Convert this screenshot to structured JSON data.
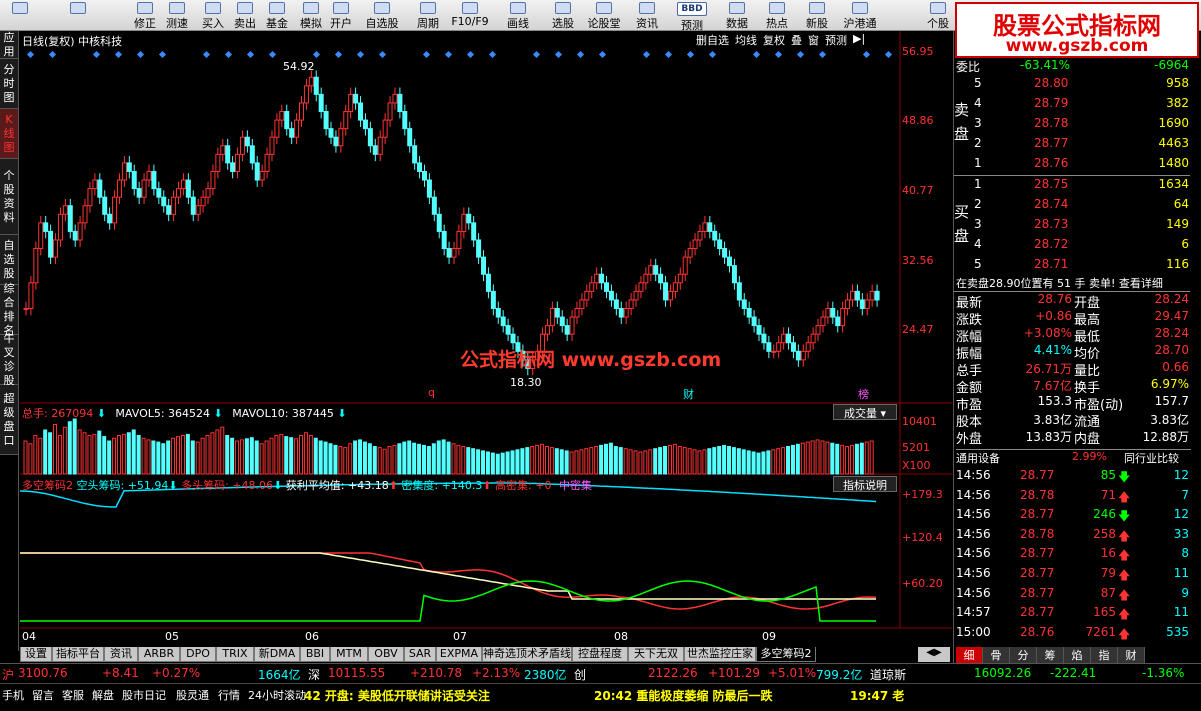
{
  "toolbar": {
    "buttons": [
      "",
      "",
      "修正",
      "测速",
      "买入",
      "卖出",
      "基金",
      "模拟",
      "开户",
      "自选股",
      "周期",
      "F10/F9",
      "画线",
      "选股",
      "论股堂",
      "资讯",
      "预测",
      "数据",
      "热点",
      "新股",
      "沪港通",
      "个股"
    ],
    "icons": [
      "home-icon",
      "back-icon",
      "fix-icon",
      "clock-icon",
      "buy-icon",
      "sell-icon",
      "fund-icon",
      "sim-icon",
      "account-icon",
      "star-icon",
      "period-icon",
      "f10-icon",
      "draw-icon",
      "pick-icon",
      "forum-icon",
      "news-icon",
      "forecast-icon",
      "pe-icon",
      "hot-icon",
      "ipo-icon",
      "hk-icon",
      "stock-icon"
    ],
    "bbd": "BBD"
  },
  "logo": {
    "line1": "股票公式指标网",
    "line2": "www.gszb.com"
  },
  "sidebar": [
    "应用",
    "分时图",
    "K线图",
    "个股资料",
    "自选股",
    "综合排名",
    "牛叉诊股",
    "超级盘口"
  ],
  "chart_header": {
    "title": "日线(复权) 中核科技",
    "menu": [
      "删自选",
      "均线",
      "复权",
      "叠",
      "窗",
      "预测"
    ]
  },
  "price_axis": [
    "56.95",
    "48.86",
    "40.77",
    "32.56",
    "24.47"
  ],
  "annotations": {
    "high": "54.92",
    "low": "18.30",
    "q": "q",
    "cai": "财",
    "bang": "榜"
  },
  "watermark": "公式指标网  www.gszb.com",
  "volume_panel": {
    "label": "总手: 267094",
    "mavol5": "MAVOL5: 364524",
    "mavol10": "MAVOL10: 387445",
    "button": "成交量",
    "axis": [
      "10401",
      "5201",
      "X100"
    ]
  },
  "indicator_panel": {
    "name": "多空筹码2",
    "kong": "空头筹码: +51.94",
    "duo": "多头筹码: +48.06",
    "avg": "获利平均值: +43.18",
    "density": "密集度: +140.3",
    "high": "高密集: +0",
    "mid": "中密集",
    "button": "指标说明",
    "axis": [
      "+179.3",
      "+120.4",
      "+60.20"
    ]
  },
  "date_axis": [
    "04",
    "05",
    "06",
    "07",
    "08",
    "09"
  ],
  "bottom_tabs": [
    "设置",
    "指标平台",
    "资讯",
    "ARBR",
    "DPO",
    "TRIX",
    "新DMA",
    "BBI",
    "MTM",
    "OBV",
    "SAR",
    "EXPMA",
    "神奇选顶术矛盾线",
    "控盘程度",
    "天下无双",
    "世杰监控庄家",
    "多空筹码2"
  ],
  "right_tabs": [
    "细",
    "骨",
    "分",
    "筹",
    "焰",
    "指",
    "财"
  ],
  "quote": {
    "weibi": {
      "label": "委比",
      "pct": "-63.41%",
      "diff": "-6964"
    },
    "sell": [
      {
        "n": "5",
        "p": "28.80",
        "v": "958"
      },
      {
        "n": "4",
        "p": "28.79",
        "v": "382"
      },
      {
        "n": "3",
        "p": "28.78",
        "v": "1690"
      },
      {
        "n": "2",
        "p": "28.77",
        "v": "4463"
      },
      {
        "n": "1",
        "p": "28.76",
        "v": "1480"
      }
    ],
    "buy": [
      {
        "n": "1",
        "p": "28.75",
        "v": "1634"
      },
      {
        "n": "2",
        "p": "28.74",
        "v": "64"
      },
      {
        "n": "3",
        "p": "28.73",
        "v": "149"
      },
      {
        "n": "4",
        "p": "28.72",
        "v": "6"
      },
      {
        "n": "5",
        "p": "28.71",
        "v": "116"
      }
    ],
    "sell_label": "卖盘",
    "buy_label": "买盘",
    "status": "在卖盘28.90位置有 51 手 卖单! 查看详细",
    "stats": [
      [
        "最新",
        "28.76",
        "开盘",
        "28.24"
      ],
      [
        "涨跌",
        "+0.86",
        "最高",
        "29.47"
      ],
      [
        "涨幅",
        "+3.08%",
        "最低",
        "28.24"
      ],
      [
        "振幅",
        "4.41%",
        "均价",
        "28.70"
      ],
      [
        "总手",
        "26.71万",
        "量比",
        "0.66"
      ],
      [
        "金额",
        "7.67亿",
        "换手",
        "6.97%"
      ],
      [
        "市盈",
        "153.3",
        "市盈(动)",
        "157.7"
      ],
      [
        "股本",
        "3.83亿",
        "流通",
        "3.83亿"
      ],
      [
        "外盘",
        "13.83万",
        "内盘",
        "12.88万"
      ]
    ],
    "industry": {
      "name": "通用设备",
      "pct": "2.99%",
      "btn": "同行业比较"
    },
    "ticks": [
      [
        "14:56",
        "28.77",
        "85",
        "down",
        "12"
      ],
      [
        "14:56",
        "28.78",
        "71",
        "up",
        "7"
      ],
      [
        "14:56",
        "28.77",
        "246",
        "down",
        "12"
      ],
      [
        "14:56",
        "28.78",
        "258",
        "up",
        "33"
      ],
      [
        "14:56",
        "28.77",
        "16",
        "up",
        "8"
      ],
      [
        "14:56",
        "28.77",
        "79",
        "up",
        "11"
      ],
      [
        "14:56",
        "28.77",
        "87",
        "up",
        "9"
      ],
      [
        "14:57",
        "28.77",
        "165",
        "up",
        "11"
      ],
      [
        "15:00",
        "28.76",
        "7261",
        "up",
        "535"
      ]
    ]
  },
  "status_bar": {
    "hu": "沪",
    "hu_val": "3100.76",
    "hu_chg": "+8.41",
    "hu_pct": "+0.27%",
    "hu_amt": "1664亿",
    "shen": "深",
    "shen_val": "10115.55",
    "shen_chg": "+210.78",
    "shen_pct": "+2.13%",
    "shen_amt": "2380亿",
    "chuang": "创",
    "chuang_val": "2122.26",
    "chuang_chg": "+101.29",
    "chuang_pct": "+5.01%",
    "chuang_amt": "799.2亿",
    "dow": "道琼斯",
    "dow_val": "16092.26",
    "dow_chg": "-222.41",
    "dow_pct": "-1.36%"
  },
  "footer": {
    "items": [
      "手机",
      "留言",
      "客服",
      "解盘",
      "股市日记",
      "股灵通",
      "行情",
      "24小时滚动"
    ],
    "news1": "42 开盘: 美股低开联储讲话受关注",
    "news2": "20:42 重能极度萎缩 防最后一跌",
    "time": "19:47 老"
  },
  "chart_data": {
    "type": "candlestick",
    "title": "日线(复权) 中核科技",
    "ylim": [
      18.3,
      56.95
    ],
    "y_ticks": [
      56.95,
      48.86,
      40.77,
      32.56,
      24.47
    ],
    "x_ticks": [
      "04",
      "05",
      "06",
      "07",
      "08",
      "09"
    ],
    "high_label": 54.92,
    "low_label": 18.3,
    "closes": [
      27,
      30,
      34,
      37,
      36,
      33,
      35,
      38,
      39,
      36,
      35,
      37,
      39,
      41,
      42,
      40,
      38,
      37,
      40,
      42,
      44,
      43,
      41,
      40,
      42,
      43,
      41,
      40,
      39,
      38,
      40,
      41,
      42,
      40,
      38,
      39,
      40,
      41,
      43,
      45,
      46,
      44,
      43,
      45,
      47,
      46,
      44,
      42,
      43,
      45,
      47,
      49,
      50,
      48,
      47,
      49,
      51,
      53,
      54,
      52,
      50,
      48,
      47,
      46,
      48,
      50,
      52,
      51,
      49,
      48,
      46,
      45,
      47,
      49,
      51,
      52,
      50,
      48,
      46,
      44,
      43,
      42,
      40,
      38,
      36,
      34,
      33,
      34,
      36,
      38,
      37,
      35,
      33,
      31,
      29,
      27,
      26,
      25,
      24,
      23,
      22,
      21,
      20,
      21,
      22,
      24,
      25,
      27,
      26,
      25,
      24,
      26,
      27,
      28,
      29,
      30,
      31,
      30,
      29,
      28,
      27,
      26,
      27,
      28,
      29,
      30,
      31,
      32,
      31,
      30,
      28,
      29,
      30,
      31,
      33,
      34,
      35,
      36,
      37,
      36,
      35,
      34,
      33,
      32,
      30,
      28,
      27,
      26,
      25,
      24,
      23,
      22,
      22,
      23,
      24,
      23,
      22,
      21,
      22,
      23,
      24,
      25,
      26,
      27,
      26,
      25,
      27,
      28,
      29,
      28,
      27,
      28,
      29,
      28
    ],
    "volume": [
      60,
      55,
      70,
      65,
      80,
      75,
      90,
      70,
      85,
      95,
      100,
      80,
      75,
      70,
      72,
      78,
      68,
      60,
      65,
      70,
      72,
      75,
      80,
      70,
      65,
      62,
      60,
      58,
      55,
      60,
      65,
      68,
      70,
      72,
      60,
      58,
      65,
      70,
      75,
      80,
      85,
      70,
      65,
      60,
      62,
      64,
      66,
      60,
      55,
      60,
      65,
      70,
      72,
      68,
      66,
      64,
      70,
      75,
      70,
      65,
      60,
      58,
      55,
      52,
      50,
      48,
      55,
      60,
      62,
      58,
      55,
      50,
      48,
      45,
      50,
      52,
      55,
      58,
      60,
      56,
      54,
      52,
      50,
      55,
      60,
      62,
      58,
      55,
      52,
      50,
      48,
      46,
      44,
      42,
      40,
      38,
      36,
      38,
      40,
      42,
      44,
      46,
      48,
      50,
      52,
      54,
      50,
      48,
      46,
      44,
      42,
      40,
      42,
      44,
      46,
      48,
      50,
      52,
      54,
      56,
      50,
      48,
      46,
      44,
      42,
      40,
      42,
      44,
      46,
      48,
      50,
      52,
      54,
      50,
      48,
      46,
      44,
      42,
      44,
      46,
      48,
      50,
      52,
      50,
      48,
      46,
      44,
      42,
      40,
      38,
      40,
      42,
      44,
      46,
      48,
      50,
      52,
      54,
      56,
      58,
      60,
      62,
      60,
      58,
      56,
      54,
      52,
      50,
      52,
      54,
      56,
      58,
      60
    ],
    "series": [
      {
        "name": "空头筹码",
        "color": "#00e0ff"
      },
      {
        "name": "多头筹码",
        "color": "#ff3333"
      },
      {
        "name": "获利平均值",
        "color": "#ffffc0"
      },
      {
        "name": "密集度",
        "color": "#00ff00"
      }
    ]
  }
}
